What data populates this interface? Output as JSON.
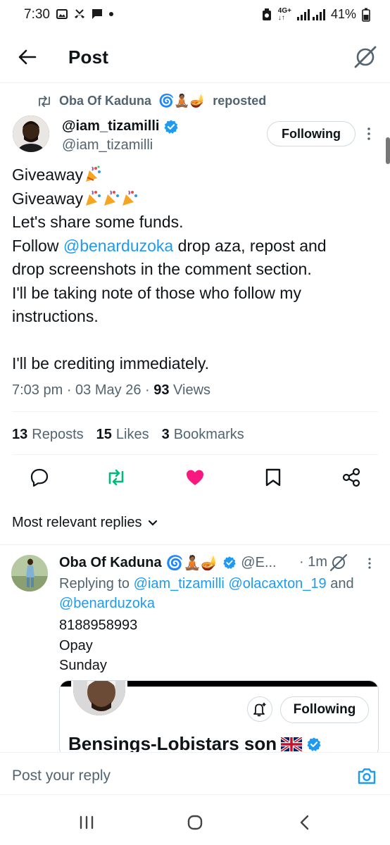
{
  "status_bar": {
    "time": "7:30",
    "network": "4G+",
    "battery": "41%"
  },
  "header": {
    "title": "Post"
  },
  "repost_banner": {
    "name": "Oba Of Kaduna",
    "emojis": "🌀🧘🏾🪔",
    "action": "reposted"
  },
  "author": {
    "display_name": "@iam_tizamilli",
    "handle": "@iam_tizamilli",
    "verified": true,
    "follow_label": "Following"
  },
  "tweet": {
    "line1": "Giveaway",
    "line2": "Giveaway",
    "line3": "Let's share some funds.",
    "line4_prefix": "Follow ",
    "line4_mention": "@benarduzoka",
    "line4_suffix": " drop aza, repost and",
    "line5": "drop screenshots in the comment section.",
    "line6": "I'll be taking note of those who follow my",
    "line7": "instructions.",
    "line8": "I'll be crediting immediately."
  },
  "meta": {
    "time": "7:03 pm",
    "date": "03 May 26",
    "views_count": "93",
    "views_label": "Views"
  },
  "stats": {
    "reposts_count": "13",
    "reposts_label": "Reposts",
    "likes_count": "15",
    "likes_label": "Likes",
    "bookmarks_count": "3",
    "bookmarks_label": "Bookmarks"
  },
  "actions": {
    "reply_icon": "reply-icon",
    "repost_icon": "repost-icon",
    "like_icon": "heart-icon",
    "bookmark_icon": "bookmark-icon",
    "share_icon": "share-icon",
    "repost_color": "#00ba7c",
    "like_color": "#f91880"
  },
  "replies_sort": {
    "label": "Most relevant replies"
  },
  "reply": {
    "name": "Oba Of Kaduna",
    "handle": "@E...",
    "time": "1m",
    "replying_label": "Replying to ",
    "replying_mentions": "@iam_tizamilli @olacaxton_19",
    "replying_and": " and",
    "replying_last": "@benarduzoka",
    "text_line1": "8188958993",
    "text_line2": "Opay",
    "text_line3": "Sunday",
    "embed_follow_label": "Following",
    "embed_name": "Bensings-Lobistars son"
  },
  "composer": {
    "placeholder": "Post your reply"
  },
  "colors": {
    "accent": "#1d9bf0",
    "secondary_text": "#536471",
    "border": "#eff3f4"
  }
}
